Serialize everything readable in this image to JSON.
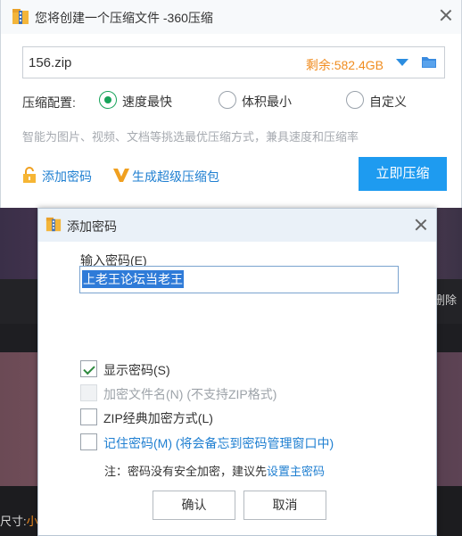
{
  "main_window": {
    "title": "您将创建一个压缩文件 -360压缩",
    "file_name": "156.zip",
    "remaining_space": "剩余:582.4GB",
    "config_label": "压缩配置:",
    "options": [
      {
        "label": "速度最快",
        "checked": true
      },
      {
        "label": "体积最小",
        "checked": false
      },
      {
        "label": "自定义",
        "checked": false
      }
    ],
    "hint": "智能为图片、视频、文档等挑选最优压缩方式，兼具速度和压缩率",
    "add_password": "添加密码",
    "super_archive": "生成超级压缩包",
    "compress_button": "立即压缩"
  },
  "background": {
    "delete_label": "删除",
    "size_label": "尺寸:",
    "size_value": "小"
  },
  "password_dialog": {
    "title": "添加密码",
    "input_label": "输入密码(E)",
    "password_value": "上老王论坛当老王",
    "checkboxes": [
      {
        "label": "显示密码(S)",
        "checked": true,
        "enabled": true
      },
      {
        "label": "加密文件名(N) (不支持ZIP格式)",
        "checked": false,
        "enabled": false
      },
      {
        "label": "ZIP经典加密方式(L)",
        "checked": false,
        "enabled": true
      },
      {
        "label": "记住密码(M) (将会备忘到密码管理窗口中)",
        "checked": false,
        "enabled": true
      }
    ],
    "note_prefix": "注：密码没有安全加密，建议先",
    "note_link": "设置主密码",
    "ok_button": "确认",
    "cancel_button": "取消"
  },
  "colors": {
    "accent_blue": "#1e9bf0",
    "link_blue": "#1f7fd1",
    "orange": "#f08c1f",
    "green": "#18a35a"
  }
}
